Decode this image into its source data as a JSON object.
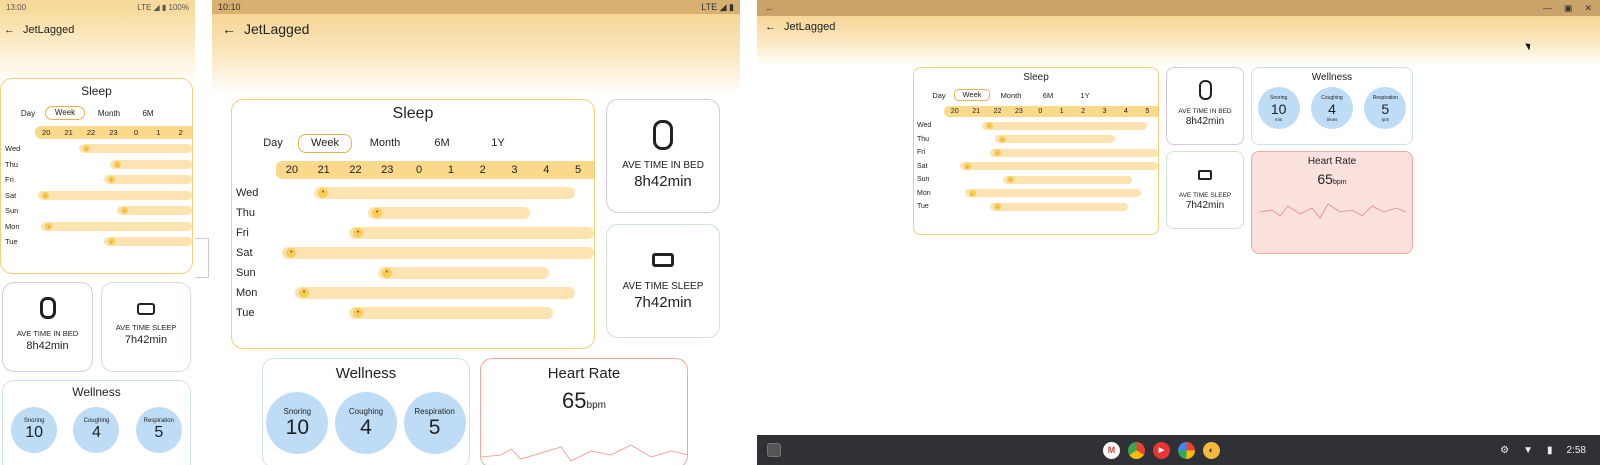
{
  "app": {
    "title": "JetLagged"
  },
  "phone": {
    "status_time": "13:00",
    "status_right": "LTE ◢ ▮ 100%"
  },
  "tablet": {
    "status_time": "10:10",
    "status_right": "LTE ◢ ▮"
  },
  "desktop": {
    "window_back": "←",
    "clock": "2:58"
  },
  "sleep": {
    "title": "Sleep",
    "tabs_full": [
      "Day",
      "Week",
      "Month",
      "6M",
      "1Y"
    ],
    "tabs_phone": [
      "Day",
      "Week",
      "Month",
      "6M"
    ],
    "selected_tab": "Week",
    "hours": [
      "20",
      "21",
      "22",
      "23",
      "0",
      "1",
      "2",
      "3",
      "4",
      "5"
    ],
    "hours_phone": [
      "20",
      "21",
      "22",
      "23",
      "0",
      "1",
      "2"
    ],
    "days": [
      {
        "label": "Wed",
        "emoji": "😀"
      },
      {
        "label": "Thu",
        "emoji": "😴"
      },
      {
        "label": "Fri",
        "emoji": "😴"
      },
      {
        "label": "Sat",
        "emoji": "😀"
      },
      {
        "label": "Sun",
        "emoji": "😊"
      },
      {
        "label": "Mon",
        "emoji": "😀"
      },
      {
        "label": "Tue",
        "emoji": "😴"
      }
    ]
  },
  "bed": {
    "label": "AVE TIME IN BED",
    "value": "8h42min"
  },
  "sleep_time": {
    "label": "AVE TIME SLEEP",
    "value": "7h42min"
  },
  "wellness": {
    "title": "Wellness",
    "items": [
      {
        "label": "Snoring",
        "value": "10",
        "unit": "min"
      },
      {
        "label": "Coughing",
        "value": "4",
        "unit": "times"
      },
      {
        "label": "Respiration",
        "value": "5",
        "unit": "rpm"
      }
    ]
  },
  "heart": {
    "title": "Heart Rate",
    "value": "65",
    "unit": "bpm"
  },
  "colors": {
    "accent": "#f5cf77",
    "bar": "#fde3b0",
    "hours": "#fbd98a",
    "wellness_circle": "#bfdcf7",
    "heart_bg": "#fbe1de"
  }
}
